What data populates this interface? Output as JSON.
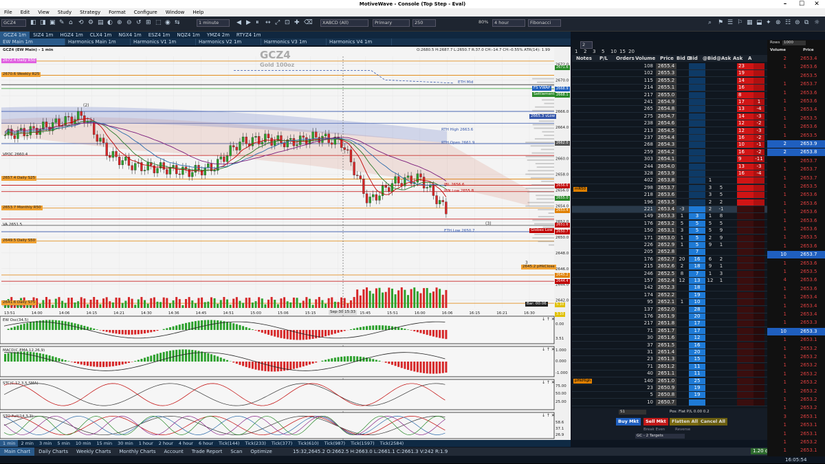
{
  "window": {
    "title": "MotiveWave - Console (Top Step - Eval)",
    "controls": [
      "–",
      "☐",
      "✕"
    ]
  },
  "menu": [
    "File",
    "Edit",
    "View",
    "Study",
    "Strategy",
    "Format",
    "Configure",
    "Window",
    "Help"
  ],
  "toolbar": {
    "symbol": "GCZ4",
    "interval": "1 minute",
    "pattern": "XABCD (All)",
    "bar_type": "Primary",
    "bars": "250",
    "zoom": "80%",
    "period": "4 hour",
    "tool": "Fibonacci"
  },
  "tabs": [
    "GCZ4 1m",
    "SIZ4 1m",
    "HGZ4 1m",
    "CLX4 1m",
    "NGX4 1m",
    "ESZ4 1m",
    "NQZ4 1m",
    "YMZ4 2m",
    "RTYZ4 1m"
  ],
  "subtabs": [
    "EW Main 1m",
    "Harmonics Main 1m",
    "Harmonics V1 1m",
    "Harmonics V2 1m",
    "Harmonics V3 1m",
    "Harmonics V4 1m"
  ],
  "chart": {
    "instrument": "GCZ4 (EW Main) - 1 min",
    "watermark_symbol": "GCZ4",
    "watermark_name": "Gold 100oz",
    "ohlc": "O:2680.5 H:2687.7 L:2650.7 R:37.0 CH:-14.7 CH:-0.55% ATR(14): 1.99",
    "bar_timer": "Bar: 00:06",
    "date_label": "Sep-30 15:33",
    "site": "motivewave.com",
    "y_ticks": [
      "2672.0",
      "2670.0",
      "2668.0",
      "2666.0",
      "2664.0",
      "2662.0",
      "2660.0",
      "2658.0",
      "2656.0",
      "2654.0",
      "2652.0",
      "2650.0",
      "2648.0",
      "2646.0",
      "2644.0",
      "2642.0"
    ],
    "x_ticks": [
      "13:51",
      "14:00",
      "14:06",
      "14:15",
      "14:21",
      "14:30",
      "14:36",
      "14:45",
      "14:51",
      "15:00",
      "15:06",
      "15:15",
      "15:21",
      "15:45",
      "15:51",
      "16:00",
      "16:06",
      "16:15",
      "16:21",
      "16:30"
    ],
    "level_labels": [
      "2672.4 Daily R50",
      "2670.6 Weekly R25",
      "VPOC 2660.4",
      "2657.4 Daily S25",
      "2653.7 Monthly R50",
      "VA 2651.5",
      "2649.5 Daily S50",
      "2641.6 Daily S75"
    ],
    "right_labels": [
      "ETH Mid",
      "FS VWAP",
      "Settlement",
      "2665.3 vLow",
      "RTH High 2663.6",
      "RTH Open 2661.9",
      "IBL 2656.6",
      "IBN Low 2655.8",
      "ETH Low 2650.7",
      "Globex Low",
      "2645.2 pHkClose"
    ],
    "price_tags": [
      "2671.6",
      "2668.9",
      "2668.1",
      "2662.0",
      "2656.6",
      "2655.0",
      "2653.4",
      "2651.6",
      "2650.7",
      "2645.2",
      "2644.4",
      "3.10",
      "5.10"
    ],
    "wave_labels": [
      "(2)",
      "(3)",
      "3"
    ],
    "indicators": [
      "EW Osc(34,5)",
      "MACD(C,EMA,12,26,9)",
      "STC(C,12,3,5,SMA)",
      "STO Full(14,3,3)"
    ],
    "indicator_values": [
      "0.00",
      "3.51",
      "1.000",
      "0.000",
      "-1.000",
      "75.00",
      "50.00",
      "25.00",
      "58.6",
      "37.1",
      "26.9"
    ]
  },
  "chart_data": {
    "type": "candlestick",
    "ylim": [
      2641,
      2673
    ],
    "x": [
      "13:51",
      "14:00",
      "14:06",
      "14:15",
      "14:21",
      "14:30",
      "14:36",
      "14:45",
      "14:51",
      "15:00",
      "15:06",
      "15:15",
      "15:21",
      "15:33",
      "15:45",
      "15:51",
      "16:00",
      "16:06"
    ],
    "close": [
      2663.0,
      2663.5,
      2664.5,
      2665.5,
      2660.5,
      2659.0,
      2658.8,
      2658.3,
      2658.8,
      2662.0,
      2662.5,
      2662.0,
      2662.8,
      2662.0,
      2654.5,
      2657.0,
      2657.5,
      2653.4
    ]
  },
  "bottom_tabs": [
    "1 min",
    "2 min",
    "3 min",
    "5 min",
    "10 min",
    "15 min",
    "30 min",
    "1 hour",
    "2 hour",
    "4 hour",
    "6 hour",
    "Tick(144)",
    "Tick(233)",
    "Tick(377)",
    "Tick(610)",
    "Tick(987)",
    "Tick(1597)",
    "Tick(2584)"
  ],
  "status_tabs": [
    "Main Chart",
    "Daily Charts",
    "Weekly Charts",
    "Monthly Charts",
    "Account",
    "Trade Report",
    "Scan",
    "Optimize"
  ],
  "status_ohlc": "15:32,2645.2 O:2662.5 H:2663.0 L:2661.1 C:2661.3 V:242 R:1.9",
  "status_right": [
    "1.20 of 1.80",
    "Sep-30 16:05:54"
  ],
  "dom": {
    "zoom_tabs": [
      "1",
      "2",
      "3",
      "5",
      "10",
      "15",
      "20"
    ],
    "spin": "2",
    "columns": [
      "Notes",
      "P/L",
      "Orders",
      "Volume",
      "Price",
      "Bid D",
      "Bid",
      "@Bid",
      "@Ask",
      "Ask",
      "A"
    ],
    "rows": [
      [
        "108",
        "2655.4",
        "",
        "",
        "",
        "23",
        ""
      ],
      [
        "102",
        "2655.3",
        "",
        "",
        "",
        "19",
        ""
      ],
      [
        "115",
        "2655.2",
        "",
        "",
        "",
        "14",
        ""
      ],
      [
        "214",
        "2655.1",
        "",
        "",
        "",
        "16",
        ""
      ],
      [
        "217",
        "2655.0",
        "",
        "",
        "",
        "8",
        ""
      ],
      [
        "241",
        "2654.9",
        "",
        "",
        "",
        "17",
        "1"
      ],
      [
        "265",
        "2654.8",
        "",
        "",
        "",
        "13",
        "-4"
      ],
      [
        "275",
        "2654.7",
        "",
        "",
        "",
        "14",
        "-3"
      ],
      [
        "238",
        "2654.6",
        "",
        "",
        "",
        "12",
        "-2"
      ],
      [
        "213",
        "2654.5",
        "",
        "",
        "",
        "12",
        "-3"
      ],
      [
        "237",
        "2654.4",
        "",
        "",
        "",
        "16",
        "-2"
      ],
      [
        "268",
        "2654.3",
        "",
        "",
        "",
        "10",
        "-1"
      ],
      [
        "259",
        "2654.2",
        "",
        "",
        "",
        "16",
        "-2"
      ],
      [
        "303",
        "2654.1",
        "",
        "",
        "",
        "9",
        "-11"
      ],
      [
        "244",
        "2654.0",
        "",
        "",
        "",
        "13",
        "-3"
      ],
      [
        "328",
        "2653.9",
        "",
        "",
        "",
        "16",
        "-4"
      ],
      [
        "402",
        "2653.8",
        "",
        "1",
        "",
        "",
        ""
      ],
      [
        "298",
        "2653.7",
        "",
        "3",
        "5",
        "",
        ""
      ],
      [
        "218",
        "2653.6",
        "",
        "3",
        "5",
        "",
        ""
      ],
      [
        "196",
        "2653.5",
        "",
        "2",
        "2",
        "",
        ""
      ],
      [
        "221",
        "2653.4",
        "-3",
        "2",
        "-1",
        "",
        ""
      ],
      [
        "149",
        "2653.3",
        "1",
        "1",
        "8",
        "",
        ""
      ],
      [
        "176",
        "2653.2",
        "5",
        "5",
        "5",
        "",
        ""
      ],
      [
        "150",
        "2653.1",
        "3",
        "5",
        "9",
        "",
        ""
      ],
      [
        "171",
        "2653.0",
        "1",
        "2",
        "9",
        "",
        ""
      ],
      [
        "226",
        "2652.9",
        "1",
        "9",
        "1",
        "",
        ""
      ],
      [
        "205",
        "2652.8",
        "",
        "",
        "",
        "",
        ""
      ],
      [
        "176",
        "2652.7",
        "20",
        "6",
        "2",
        "",
        ""
      ],
      [
        "215",
        "2652.6",
        "2",
        "9",
        "1",
        "",
        ""
      ],
      [
        "246",
        "2652.5",
        "8",
        "1",
        "3",
        "",
        ""
      ],
      [
        "157",
        "2652.4",
        "12",
        "12",
        "1",
        "",
        ""
      ],
      [
        "142",
        "2652.3",
        "",
        "",
        "",
        "",
        ""
      ],
      [
        "174",
        "2652.2",
        "",
        "",
        "",
        "",
        ""
      ],
      [
        "95",
        "2652.1",
        "1",
        "",
        "",
        "",
        ""
      ],
      [
        "137",
        "2652.0",
        "",
        "",
        "",
        "",
        ""
      ],
      [
        "176",
        "2651.9",
        "",
        "",
        "",
        "",
        ""
      ],
      [
        "217",
        "2651.8",
        "",
        "",
        "",
        "",
        ""
      ],
      [
        "71",
        "2651.7",
        "",
        "",
        "",
        "",
        ""
      ],
      [
        "30",
        "2651.6",
        "",
        "",
        "",
        "",
        ""
      ],
      [
        "37",
        "2651.5",
        "",
        "",
        "",
        "",
        ""
      ],
      [
        "31",
        "2651.4",
        "",
        "",
        "",
        "",
        ""
      ],
      [
        "23",
        "2651.3",
        "",
        "",
        "",
        "",
        ""
      ],
      [
        "71",
        "2651.2",
        "",
        "",
        "",
        "",
        ""
      ],
      [
        "40",
        "2651.1",
        "",
        "",
        "",
        "",
        ""
      ],
      [
        "140",
        "2651.0",
        "",
        "",
        "",
        "",
        ""
      ],
      [
        "23",
        "2650.9",
        "",
        "",
        "",
        "",
        ""
      ],
      [
        "5",
        "2650.8",
        "",
        "",
        "",
        "",
        ""
      ],
      [
        "10",
        "2650.7",
        "",
        "",
        "",
        "",
        ""
      ]
    ],
    "bid_sizes": [
      "",
      "",
      "",
      "",
      "",
      "",
      "",
      "",
      "",
      "",
      "",
      "",
      "",
      "",
      "",
      "",
      "",
      "",
      "",
      "",
      "",
      "3",
      "5",
      "5",
      "5",
      "5",
      "7",
      "16",
      "18",
      "7",
      "13",
      "18",
      "19",
      "10",
      "28",
      "20",
      "17",
      "17",
      "12",
      "16",
      "20",
      "15",
      "11",
      "11",
      "25",
      "19",
      "19",
      ""
    ],
    "tags": [
      "mR50",
      "pHkHigh"
    ],
    "position": "Pos: Flat P/L 0.00 0.2",
    "account": "S1",
    "buttons": {
      "buy": "Buy Mkt",
      "sell": "Sell Mkt",
      "flatten": "Flatten All",
      "cancel": "Cancel All",
      "break": "Break Even",
      "reverse": "Reverse",
      "targets": "GC - 2 Targets"
    }
  },
  "ladder": {
    "rows_label": "Rows",
    "rows_value": "1000",
    "columns": [
      "Volume",
      "Price"
    ],
    "rows": [
      [
        "2",
        "2653.4"
      ],
      [
        "1",
        "2653.6"
      ],
      [
        "",
        "2653.5"
      ],
      [
        "1",
        "2653.7"
      ],
      [
        "1",
        "2653.6"
      ],
      [
        "1",
        "2653.6"
      ],
      [
        "1",
        "2653.4"
      ],
      [
        "1",
        "2653.5"
      ],
      [
        "1",
        "2653.6"
      ],
      [
        "1",
        "2653.5"
      ],
      [
        "2",
        "2653.9"
      ],
      [
        "2",
        "2653.8"
      ],
      [
        "1",
        "2653.7"
      ],
      [
        "1",
        "2653.7"
      ],
      [
        "1",
        "2653.7"
      ],
      [
        "1",
        "2653.5"
      ],
      [
        "1",
        "2653.6"
      ],
      [
        "1",
        "2653.6"
      ],
      [
        "1",
        "2653.6"
      ],
      [
        "1",
        "2653.6"
      ],
      [
        "1",
        "2653.6"
      ],
      [
        "1",
        "2653.5"
      ],
      [
        "1",
        "2653.6"
      ],
      [
        "10",
        "2653.7"
      ],
      [
        "1",
        "2653.6"
      ],
      [
        "1",
        "2653.5"
      ],
      [
        "4",
        "2653.6"
      ],
      [
        "1",
        "2653.6"
      ],
      [
        "1",
        "2653.4"
      ],
      [
        "1",
        "2653.4"
      ],
      [
        "1",
        "2653.4"
      ],
      [
        "1",
        "2653.3"
      ],
      [
        "10",
        "2653.3"
      ],
      [
        "1",
        "2653.1"
      ],
      [
        "1",
        "2653.2"
      ],
      [
        "1",
        "2653.2"
      ],
      [
        "1",
        "2653.2"
      ],
      [
        "1",
        "2653.2"
      ],
      [
        "1",
        "2653.2"
      ],
      [
        "1",
        "2653.2"
      ],
      [
        "1",
        "2653.2"
      ],
      [
        "1",
        "2653.2"
      ],
      [
        "3",
        "2653.1"
      ],
      [
        "1",
        "2653.1"
      ],
      [
        "1",
        "2653.1"
      ],
      [
        "1",
        "2653.2"
      ],
      [
        "1",
        "2653.1"
      ]
    ]
  },
  "colors": {
    "bid_blue": "#1e7ad6",
    "ask_red": "#d01515",
    "up": "#2ca02c",
    "down": "#d62728",
    "orange_level": "#e08000",
    "red_level": "#c00000"
  }
}
